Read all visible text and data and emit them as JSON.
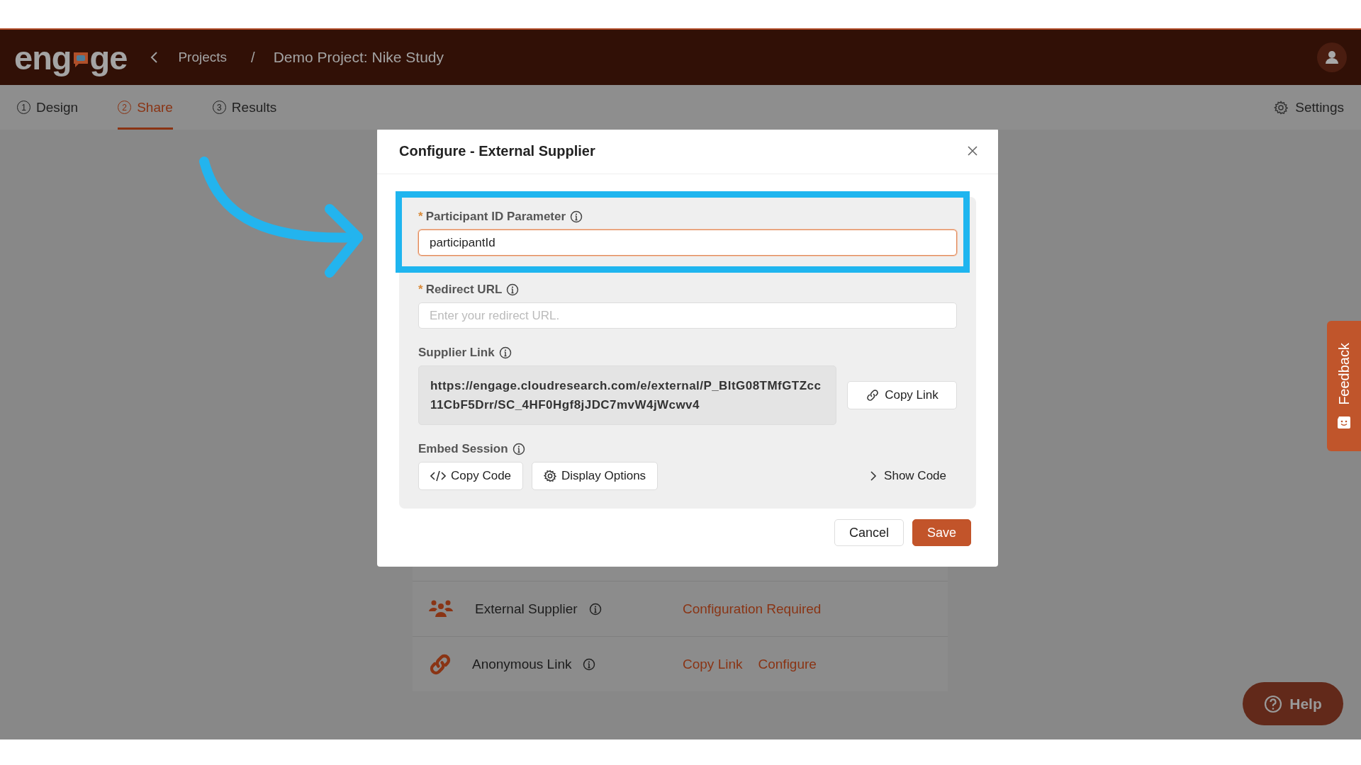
{
  "top_bar": {
    "logo": [
      "eng",
      "ge"
    ],
    "breadcrumb": [
      {
        "label": "Projects"
      },
      {
        "label": "Demo Project: Nike Study"
      }
    ],
    "separator": "/"
  },
  "tabs": [
    {
      "index": "1",
      "label": "Design",
      "selected": false
    },
    {
      "index": "2",
      "label": "Share",
      "selected": true
    },
    {
      "index": "3",
      "label": "Results",
      "selected": false
    }
  ],
  "settings": {
    "label": "Settings"
  },
  "channels": [
    {
      "kind": "group",
      "name": "External Supplier",
      "actions": [
        {
          "label": "Configuration Required"
        }
      ]
    },
    {
      "kind": "link",
      "name": "Anonymous Link",
      "actions": [
        {
          "label": "Copy Link"
        },
        {
          "label": "Configure"
        }
      ]
    }
  ],
  "modal": {
    "title": "Configure - External Supplier",
    "fields": [
      {
        "kind": "input",
        "label": "Participant ID Parameter",
        "required_mark": "*",
        "highlighted": true,
        "value": "participantId"
      },
      {
        "kind": "input",
        "label": "Redirect URL",
        "required_mark": "*",
        "highlighted": false,
        "placeholder": "Enter your redirect URL."
      },
      {
        "kind": "link",
        "label": "Supplier Link",
        "link": "https://engage.cloudresearch.com/e/external/P_BltG08TMfGTZcc11CbF5Drr/SC_4HF0Hgf8jJDC7mvW4jWcwv4",
        "button": "Copy Link"
      },
      {
        "kind": "embed",
        "label": "Embed Session",
        "buttons": [
          {
            "kind": "code",
            "label": "Copy Code"
          },
          {
            "kind": "gear",
            "label": "Display Options"
          }
        ],
        "toggle": "Show Code"
      }
    ],
    "buttons": [
      {
        "kind": "secondary",
        "label": "Cancel"
      },
      {
        "kind": "primary",
        "label": "Save"
      }
    ]
  },
  "feedback": {
    "label": "Feedback"
  },
  "help": {
    "label": "Help"
  }
}
